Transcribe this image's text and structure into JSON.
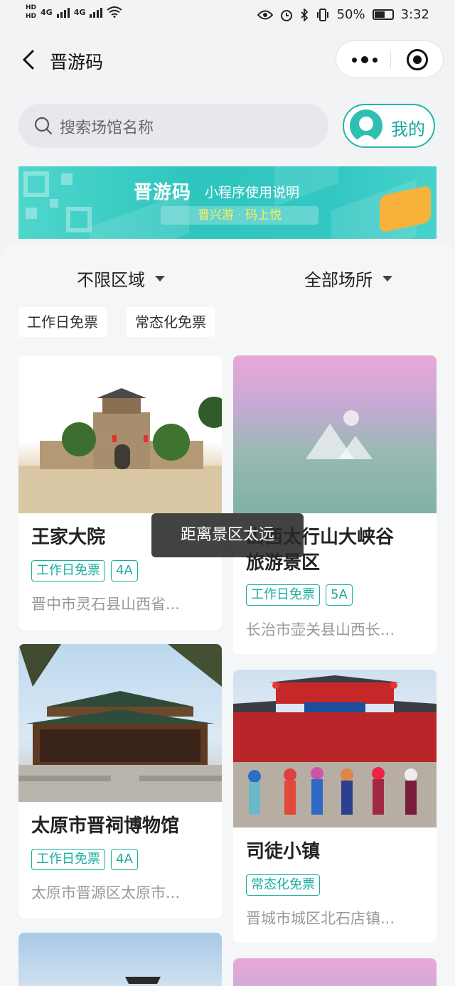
{
  "status_bar": {
    "hd_top": "HD",
    "hd_bottom": "HD",
    "net1": "4G",
    "net2": "4G",
    "battery": "50%",
    "time": "3:32"
  },
  "navbar": {
    "title": "晋游码"
  },
  "search": {
    "placeholder": "搜索场馆名称",
    "mine_label": "我的"
  },
  "banner": {
    "title": "晋游码",
    "subtitle": "小程序使用说明",
    "slogan": "晋兴游 · 码上悦"
  },
  "filters": {
    "region": "不限区域",
    "venue": "全部场所"
  },
  "chips": [
    "工作日免票",
    "常态化免票"
  ],
  "cards": [
    {
      "name": "王家大院",
      "tags": [
        "工作日免票",
        "4A"
      ],
      "address": "晋中市灵石县山西省..."
    },
    {
      "name": "山西太行山大峡谷\n旅游景区",
      "tags": [
        "工作日免票",
        "5A"
      ],
      "address": "长治市壶关县山西长..."
    },
    {
      "name": "太原市晋祠博物馆",
      "tags": [
        "工作日免票",
        "4A"
      ],
      "address": "太原市晋源区太原市..."
    },
    {
      "name": "司徒小镇",
      "tags": [
        "常态化免票"
      ],
      "address": "晋城市城区北石店镇..."
    }
  ],
  "toast": "距离景区太远",
  "colors": {
    "accent": "#19ad9f",
    "banner": "#33c7c2"
  }
}
